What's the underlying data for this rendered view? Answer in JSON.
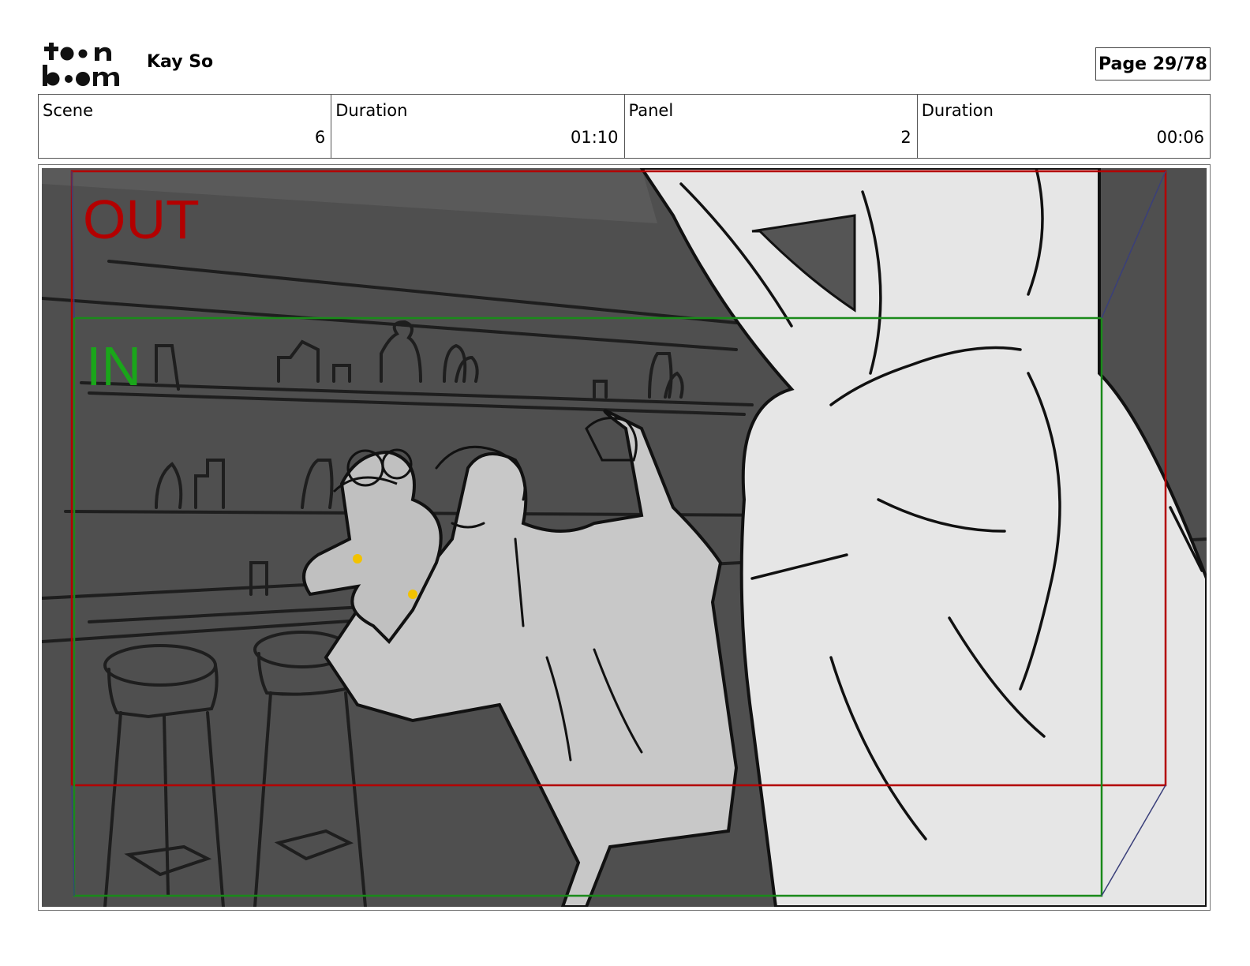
{
  "logo": {
    "line1": "toon",
    "line2": "boom"
  },
  "header": {
    "author": "Kay So",
    "page": "Page 29/78"
  },
  "info": [
    {
      "label": "Scene",
      "value": "6"
    },
    {
      "label": "Duration",
      "value": "01:10"
    },
    {
      "label": "Panel",
      "value": "2"
    },
    {
      "label": "Duration",
      "value": "00:06"
    }
  ],
  "panel": {
    "out_label": "OUT",
    "in_label": "IN",
    "colors": {
      "out_frame": "#b30000",
      "in_frame": "#1a8a1a",
      "background": "#555555"
    }
  }
}
